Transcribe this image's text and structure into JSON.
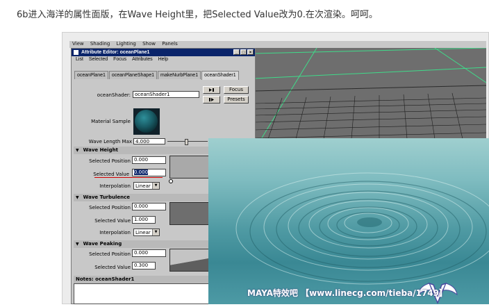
{
  "caption": "6b进入海洋的属性面版，在Wave Height里，把Selected Value改为0.在次渲染。呵呵。",
  "maya_menu": [
    "View",
    "Shading",
    "Lighting",
    "Show",
    "Panels"
  ],
  "editor": {
    "title": "Attribute Editor: oceanPlane1",
    "window_buttons": [
      "_",
      "□",
      "×"
    ],
    "menu": [
      "List",
      "Selected",
      "Focus",
      "Attributes",
      "Help"
    ],
    "tabs": [
      "oceanPlane1",
      "oceanPlaneShape1",
      "makeNurbPlane1",
      "oceanShader1"
    ],
    "active_tab_index": 3,
    "shader_label": "oceanShader:",
    "shader_value": "oceanShader1",
    "focus_label": "Focus",
    "presets_label": "Presets",
    "material_sample_label": "Material Sample",
    "wave_length_max_label": "Wave Length Max",
    "wave_length_max_value": "4.000",
    "sections": {
      "wave_height": {
        "title": "Wave Height",
        "pos_label": "Selected Position",
        "pos_value": "0.000",
        "val_label": "Selected Value",
        "val_value": "0.000",
        "interp_label": "Interpolation",
        "interp_value": "Linear"
      },
      "wave_turbulence": {
        "title": "Wave Turbulence",
        "pos_label": "Selected Position",
        "pos_value": "0.000",
        "val_label": "Selected Value",
        "val_value": "1.000",
        "interp_label": "Interpolation",
        "interp_value": "Linear"
      },
      "wave_peaking": {
        "title": "Wave Peaking",
        "pos_label": "Selected Position",
        "pos_value": "0.000",
        "val_label": "Selected Value",
        "val_value": "0.300"
      }
    },
    "notes_title": "Notes: oceanShader1"
  },
  "watermark": "MAYA特效吧 【www.linecg.com/tieba/1749】",
  "colors": {
    "title_bar": "#0a246a",
    "panel": "#c8c8c8",
    "grid_line": "#3fdc8a",
    "highlight_underline": "#d00000"
  }
}
